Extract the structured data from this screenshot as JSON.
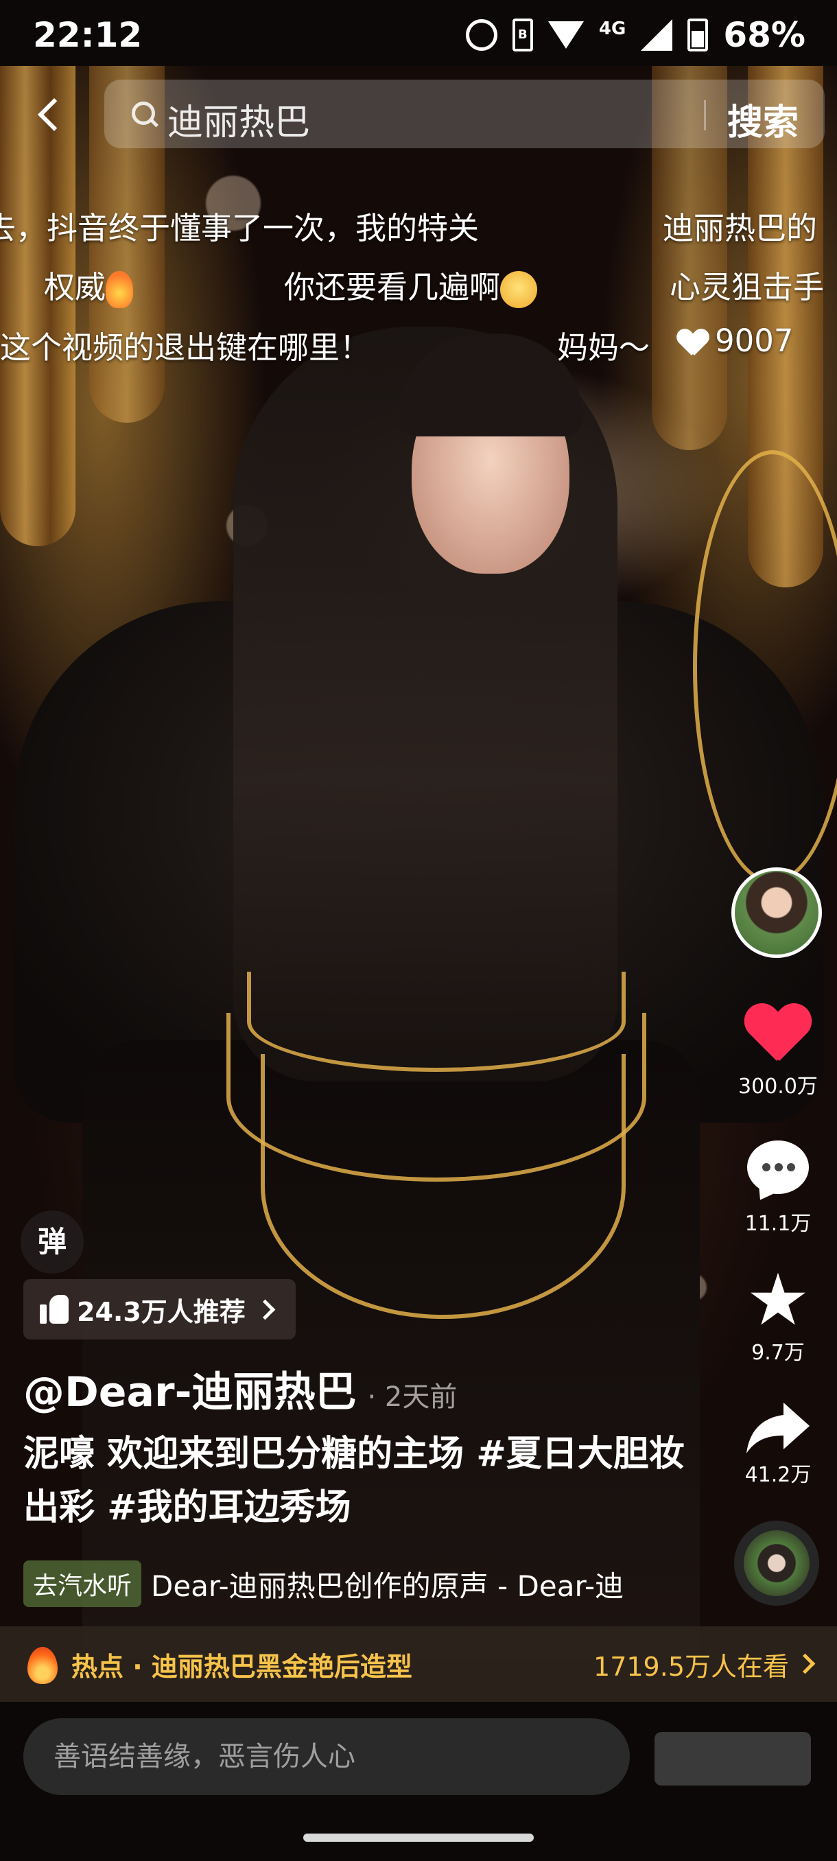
{
  "status_bar": {
    "time": "22:12",
    "network": "4G",
    "battery": "68%",
    "icons": [
      "alarm-icon",
      "hd-icon",
      "wifi-icon",
      "signal-icon",
      "battery-icon"
    ]
  },
  "search": {
    "query": "迪丽热巴",
    "submit_label": "搜索"
  },
  "danmaku": [
    {
      "text": "去，抖音终于懂事了一次，我的特关"
    },
    {
      "text": "迪丽热巴的"
    },
    {
      "text": "权威"
    },
    {
      "text": "你还要看几遍啊"
    },
    {
      "text": "心灵狙击手"
    },
    {
      "text": "这个视频的退出键在哪里！"
    },
    {
      "text": "妈妈～"
    },
    {
      "text": "9007"
    }
  ],
  "rail": {
    "like_count": "300.0万",
    "comment_count": "11.1万",
    "favorite_count": "9.7万",
    "share_count": "41.2万",
    "like_color": "#fe2c55"
  },
  "video_info": {
    "danmu_button": "弹",
    "recommend": "24.3万人推荐",
    "author": "@Dear-迪丽热巴",
    "post_time": "· 2天前",
    "caption": "泥嚎 欢迎来到巴分糖的主场 #夏日大胆妆出彩 #我的耳边秀场",
    "music_tag": "去汽水听",
    "music_text": "Dear-迪丽热巴创作的原声 - Dear-迪"
  },
  "hot_topic": {
    "label": "热点 · 迪丽热巴黑金艳后造型",
    "viewers": "1719.5万人在看",
    "color": "#f7c34a"
  },
  "comment_box": {
    "placeholder": "善语结善缘，恶言伤人心"
  }
}
